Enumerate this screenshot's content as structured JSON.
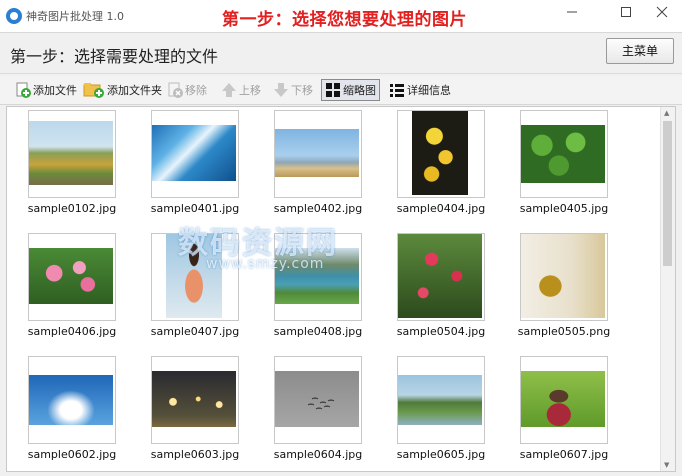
{
  "app": {
    "title": "神奇图片批处理 1.0",
    "banner": "第一步：选择您想要处理的图片"
  },
  "step": {
    "label": "第一步：选择需要处理的文件",
    "menu_button": "主菜单"
  },
  "toolbar": {
    "add_file": "添加文件",
    "add_folder": "添加文件夹",
    "remove": "移除",
    "move_up": "上移",
    "move_down": "下移",
    "thumbnails": "缩略图",
    "details": "详细信息"
  },
  "files": [
    {
      "name": "sample0102.jpg",
      "icon": "photo-flowers-park"
    },
    {
      "name": "sample0401.jpg",
      "icon": "photo-blue-abstract"
    },
    {
      "name": "sample0402.jpg",
      "icon": "photo-coast-town"
    },
    {
      "name": "sample0404.jpg",
      "icon": "photo-yellow-ginkgo"
    },
    {
      "name": "sample0405.jpg",
      "icon": "photo-green-leaves"
    },
    {
      "name": "sample0406.jpg",
      "icon": "photo-pink-blossoms"
    },
    {
      "name": "sample0407.jpg",
      "icon": "photo-woman-portrait"
    },
    {
      "name": "sample0408.jpg",
      "icon": "photo-lake-mountains"
    },
    {
      "name": "sample0504.jpg",
      "icon": "photo-red-flowers"
    },
    {
      "name": "sample0505.png",
      "icon": "photo-bottle"
    },
    {
      "name": "sample0602.jpg",
      "icon": "photo-blue-sky"
    },
    {
      "name": "sample0603.jpg",
      "icon": "photo-night-lights"
    },
    {
      "name": "sample0604.jpg",
      "icon": "photo-birds-grey-sky"
    },
    {
      "name": "sample0605.jpg",
      "icon": "photo-river-bank"
    },
    {
      "name": "sample0607.jpg",
      "icon": "photo-girl-field"
    }
  ],
  "watermark": {
    "main": "数码资源网",
    "sub": "www.smzy.com"
  }
}
